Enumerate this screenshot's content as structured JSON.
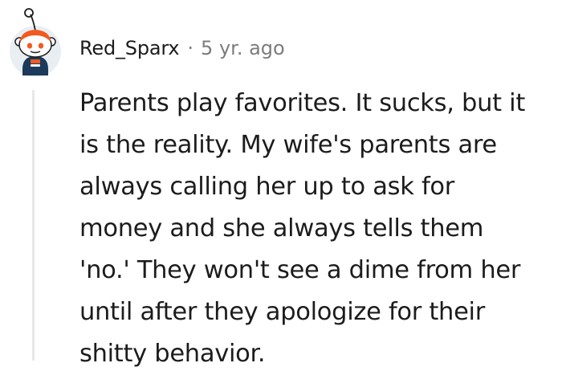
{
  "comment": {
    "author": "Red_Sparx",
    "separator": "·",
    "timestamp": "5 yr. ago",
    "avatar_icon": "snoo-avatar-icon",
    "body_lines": [
      "Parents play favorites. It sucks, but it",
      "is the reality. My wife's parents are",
      "always calling her up to ask for",
      "money and she always tells them",
      "'no.' They won't see a dime from her",
      "until after they apologize for their",
      "shitty behavior."
    ]
  },
  "colors": {
    "text": "#1c1c1c",
    "meta": "#7c7c7c",
    "thread_line": "#e8e8e8",
    "avatar_bg": "#e9eef2",
    "snoo_orange": "#f25a1f",
    "snoo_navy": "#1c3a5c"
  }
}
